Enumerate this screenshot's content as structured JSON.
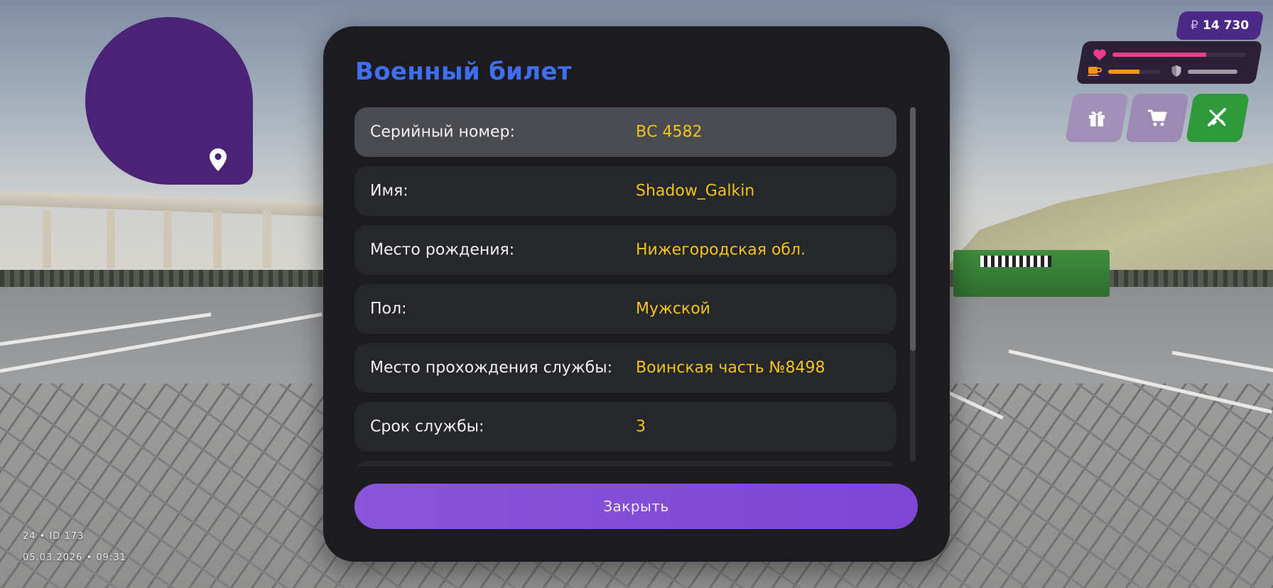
{
  "hud": {
    "money": {
      "currency_symbol": "₽",
      "amount": "14 730"
    },
    "stats": {
      "health_fraction": 0.7,
      "food_fraction": 0.6,
      "armor_fraction": 0.0
    },
    "buttons": [
      {
        "name": "gift",
        "icon": "gift-icon"
      },
      {
        "name": "shop",
        "icon": "cart-icon"
      },
      {
        "name": "weapons",
        "icon": "crossed-guns-icon"
      }
    ],
    "colors": {
      "money_bg": "#4a2a86",
      "health": "#ec3d8f",
      "food": "#f29418",
      "weapons_btn": "#2e9a3c"
    }
  },
  "player_info": {
    "line1": "24 • ID 173",
    "line2": "05.03.2026 • 09:31"
  },
  "minimap": {
    "color": "#4a2377",
    "icon": "location-pin-icon"
  },
  "dialog": {
    "title": "Военный билет",
    "rows": [
      {
        "label": "Серийный номер:",
        "value": "ВС 4582",
        "highlighted": true
      },
      {
        "label": "Имя:",
        "value": "Shadow_Galkin"
      },
      {
        "label": "Место рождения:",
        "value": "Нижегородская обл."
      },
      {
        "label": "Пол:",
        "value": "Мужской"
      },
      {
        "label": "Место прохождения службы:",
        "value": "Воинская часть №8498"
      },
      {
        "label": "Срок службы:",
        "value": "3"
      }
    ],
    "close_label": "Закрыть",
    "colors": {
      "title": "#3f6ef0",
      "value": "#f1c31b",
      "button": "#8a55d9"
    }
  }
}
